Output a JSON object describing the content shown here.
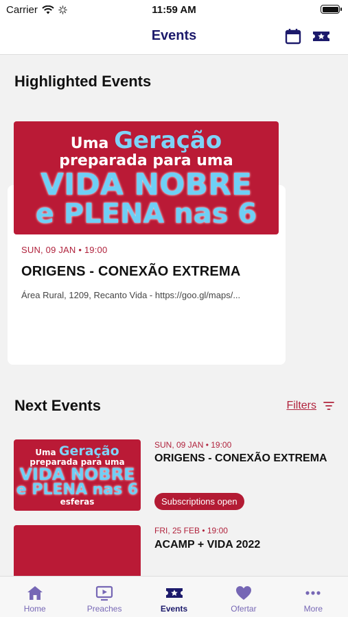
{
  "status_bar": {
    "carrier": "Carrier",
    "time": "11:59 AM"
  },
  "nav": {
    "title": "Events",
    "calendar_icon": "calendar-icon",
    "ticket_icon": "ticket-icon"
  },
  "highlighted": {
    "section_title": "Highlighted Events",
    "event": {
      "banner": {
        "line1a": "Uma",
        "line1b": "Geração",
        "line2": "preparada para uma",
        "line3": "VIDA NOBRE",
        "line4": "e PLENA nas 6"
      },
      "date": "SUN, 09 JAN • 19:00",
      "name": "ORIGENS - CONEXÃO EXTREMA",
      "place": "Área Rural, 1209, Recanto Vida - https://goo.gl/maps/..."
    }
  },
  "next": {
    "section_title": "Next Events",
    "filters_label": "Filters",
    "events": [
      {
        "banner": {
          "line1a": "Uma",
          "line1b": "Geração",
          "line2": "preparada para uma",
          "line3": "VIDA NOBRE",
          "line4": "e PLENA nas 6",
          "line5": "esferas"
        },
        "date": "SUN, 09 JAN • 19:00",
        "name": "ORIGENS - CONEXÃO EXTREMA",
        "badge": "Subscriptions open"
      },
      {
        "date": "FRI, 25 FEB • 19:00",
        "name": "ACAMP + VIDA 2022"
      }
    ]
  },
  "tabs": [
    {
      "label": "Home",
      "icon": "home-icon"
    },
    {
      "label": "Preaches",
      "icon": "tv-play-icon"
    },
    {
      "label": "Events",
      "icon": "ticket-icon",
      "active": true
    },
    {
      "label": "Ofertar",
      "icon": "heart-icon"
    },
    {
      "label": "More",
      "icon": "more-dots-icon"
    }
  ],
  "colors": {
    "brand_navy": "#1c1a6b",
    "accent_red": "#b0223c",
    "banner_red": "#ba1a36",
    "tab_inactive": "#7667b5"
  }
}
